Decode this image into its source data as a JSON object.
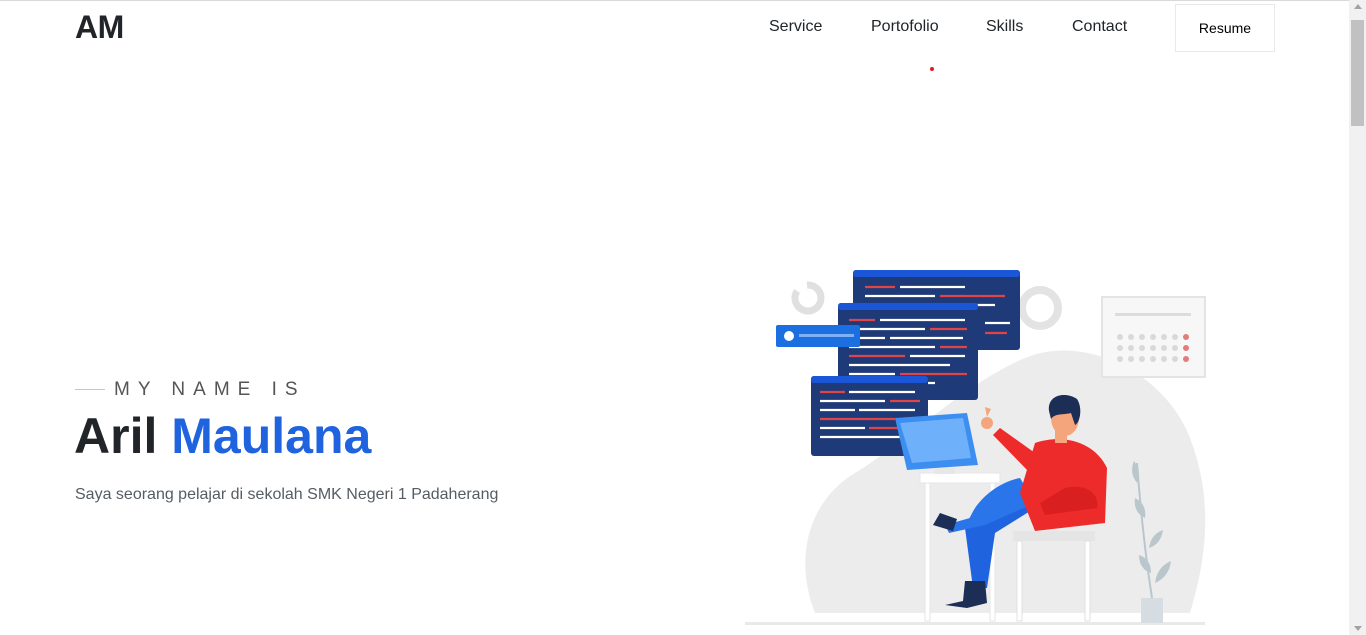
{
  "navbar": {
    "brand": "AM",
    "links": [
      "Service",
      "Portofolio",
      "Skills",
      "Contact"
    ],
    "resume_label": "Resume"
  },
  "hero": {
    "intro_label": "MY NAME IS",
    "first_name": "Aril",
    "last_name": "Maulana",
    "description": "Saya seorang pelajar di sekolah SMK Negeri 1 Padaherang"
  },
  "colors": {
    "accent": "#1f63de",
    "nav_indicator": "#e31b23",
    "text": "#212529"
  },
  "illustration": {
    "icon": "developer-at-computer-illustration"
  }
}
